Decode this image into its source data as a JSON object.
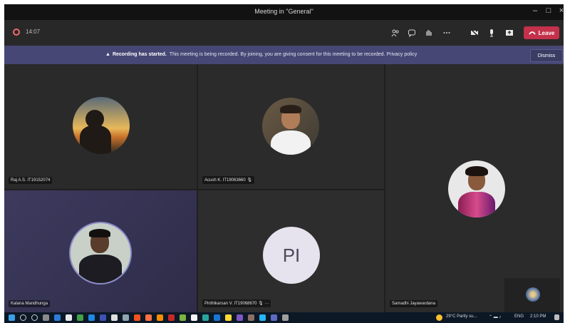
{
  "window": {
    "title": "Meeting in \"General\"",
    "controls": [
      "–",
      "□",
      "×"
    ]
  },
  "toolbar": {
    "timer": "14:07",
    "leave_label": "Leave",
    "colors": {
      "leave": "#c4314b",
      "timer_icon": "#f06b6b"
    }
  },
  "banner": {
    "bold_text": "Recording has started.",
    "text": "This meeting is being recorded. By joining, you are giving consent for this meeting to be recorded. Privacy policy",
    "dismiss_label": "Dismiss",
    "color": "#464775"
  },
  "participants": [
    {
      "name": "Raj A.S. IT19152074",
      "avatar": "photo-silhouette-sunset"
    },
    {
      "name": "Acush K. IT19063660",
      "avatar": "photo-man-smiling"
    },
    {
      "name": "Samadhi Jayawardana",
      "avatar": "photo-woman-saree"
    },
    {
      "name": "Kalana Mandhunga",
      "avatar": "photo-person-framed"
    },
    {
      "name": "Pinthikarsan V. IT19068670",
      "initials": "PI"
    }
  ],
  "taskbar": {
    "weather": "29°C Partly su...",
    "lang": "ENG",
    "time": "2:10 PM"
  }
}
